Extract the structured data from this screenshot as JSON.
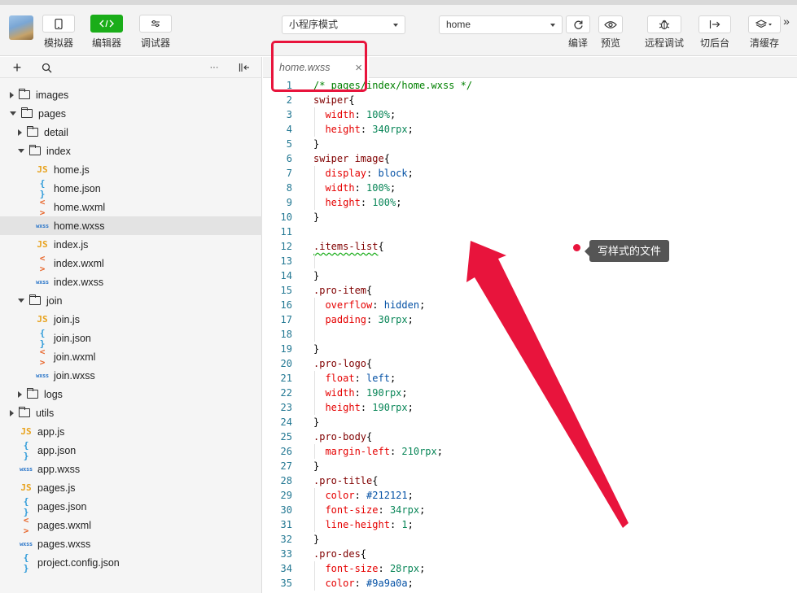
{
  "toolbar": {
    "simulator_label": "模拟器",
    "editor_label": "编辑器",
    "debugger_label": "调试器",
    "mode_select": "小程序模式",
    "page_select": "home",
    "compile_label": "编译",
    "preview_label": "预览",
    "remote_debug_label": "远程调试",
    "background_label": "切后台",
    "clear_cache_label": "清缓存",
    "more_label": "»"
  },
  "sidebar": {
    "tools": {
      "add": "+",
      "more": "···"
    },
    "tree": [
      {
        "label": "images",
        "type": "folder",
        "indent": 0,
        "expanded": false
      },
      {
        "label": "pages",
        "type": "folder",
        "indent": 0,
        "expanded": true
      },
      {
        "label": "detail",
        "type": "folder",
        "indent": 1,
        "expanded": false
      },
      {
        "label": "index",
        "type": "folder",
        "indent": 1,
        "expanded": true
      },
      {
        "label": "home.js",
        "type": "js",
        "indent": 2
      },
      {
        "label": "home.json",
        "type": "json",
        "indent": 2
      },
      {
        "label": "home.wxml",
        "type": "wxml",
        "indent": 2
      },
      {
        "label": "home.wxss",
        "type": "wxss",
        "indent": 2,
        "selected": true
      },
      {
        "label": "index.js",
        "type": "js",
        "indent": 2
      },
      {
        "label": "index.wxml",
        "type": "wxml",
        "indent": 2
      },
      {
        "label": "index.wxss",
        "type": "wxss",
        "indent": 2
      },
      {
        "label": "join",
        "type": "folder",
        "indent": 1,
        "expanded": true
      },
      {
        "label": "join.js",
        "type": "js",
        "indent": 2
      },
      {
        "label": "join.json",
        "type": "json",
        "indent": 2
      },
      {
        "label": "join.wxml",
        "type": "wxml",
        "indent": 2
      },
      {
        "label": "join.wxss",
        "type": "wxss",
        "indent": 2
      },
      {
        "label": "logs",
        "type": "folder",
        "indent": 1,
        "expanded": false
      },
      {
        "label": "utils",
        "type": "folder",
        "indent": 0,
        "expanded": false
      },
      {
        "label": "app.js",
        "type": "js",
        "indent": 0
      },
      {
        "label": "app.json",
        "type": "json",
        "indent": 0
      },
      {
        "label": "app.wxss",
        "type": "wxss",
        "indent": 0
      },
      {
        "label": "pages.js",
        "type": "js",
        "indent": 0
      },
      {
        "label": "pages.json",
        "type": "json",
        "indent": 0
      },
      {
        "label": "pages.wxml",
        "type": "wxml",
        "indent": 0
      },
      {
        "label": "pages.wxss",
        "type": "wxss",
        "indent": 0
      },
      {
        "label": "project.config.json",
        "type": "json",
        "indent": 0
      }
    ],
    "icon_glyphs": {
      "js": "JS",
      "json": "{ }",
      "wxml": "< >",
      "wxss": "wxss"
    }
  },
  "editor": {
    "tab_title": "home.wxss",
    "tab_close": "×",
    "lines": [
      "/* pages/index/home.wxss */",
      "swiper{",
      "  width: 100%;",
      "  height: 340rpx;",
      "}",
      "swiper image{",
      "  display: block;",
      "  width: 100%;",
      "  height: 100%;",
      "}",
      "",
      ".items-list{",
      "",
      "}",
      ".pro-item{",
      "  overflow: hidden;",
      "  padding: 30rpx;",
      "",
      "}",
      ".pro-logo{",
      "  float: left;",
      "  width: 190rpx;",
      "  height: 190rpx;",
      "}",
      ".pro-body{",
      "  margin-left: 210rpx;",
      "}",
      ".pro-title{",
      "  color: #212121;",
      "  font-size: 34rpx;",
      "  line-height: 1;",
      "}",
      ".pro-des{",
      "  font-size: 28rpx;",
      "  color: #9a9a0a;"
    ]
  },
  "annotation": {
    "tooltip": "写样式的文件",
    "color": "#e8143c"
  }
}
